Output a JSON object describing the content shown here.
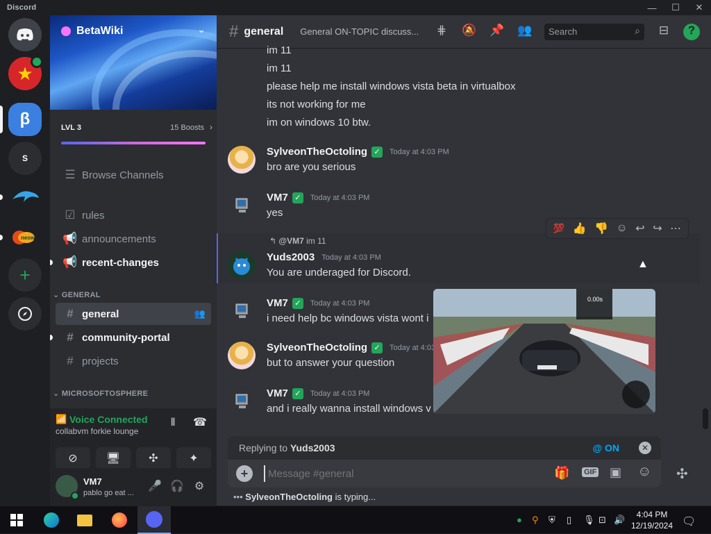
{
  "app": {
    "title": "Discord"
  },
  "window_controls": {
    "minimize": "—",
    "maximize": "☐",
    "close": "✕"
  },
  "servers": [
    {
      "name": "discord-home",
      "glyph": "",
      "color": "#404249"
    },
    {
      "name": "server-red",
      "glyph": "",
      "color": "#d7262a"
    },
    {
      "name": "server-betawiki",
      "glyph": "β",
      "color": "#3b7fe0"
    },
    {
      "name": "server-s",
      "glyph": "S",
      "color": "#2b2d31"
    },
    {
      "name": "server-dolphin",
      "glyph": "",
      "color": "#1e1f22"
    },
    {
      "name": "server-neowin",
      "glyph": "",
      "color": "#1e1f22"
    }
  ],
  "sidebar": {
    "server_name": "BetaWiki",
    "level": "LVL 3",
    "boosts": "15 Boosts",
    "browse": "Browse Channels",
    "channels_top": [
      {
        "name": "rules",
        "icon": "rules-icon"
      },
      {
        "name": "announcements",
        "icon": "megaphone-icon"
      },
      {
        "name": "recent-changes",
        "icon": "megaphone-icon"
      }
    ],
    "category_general": "GENERAL",
    "channels_general": [
      {
        "name": "general"
      },
      {
        "name": "community-portal"
      },
      {
        "name": "projects"
      }
    ],
    "category_ms": "MICROSOFTOSPHERE"
  },
  "voice": {
    "status": "Voice Connected",
    "location": "collabvm forkie lounge"
  },
  "user": {
    "name": "VM7",
    "status": "pablo go eat ..."
  },
  "header": {
    "channel": "general",
    "topic": "General ON-TOPIC discuss...",
    "search_placeholder": "Search"
  },
  "messages": {
    "continued": [
      "im 11",
      "im 11",
      "please help me install windows vista beta in virtualbox",
      "its not working for me",
      "im on windows 10 btw."
    ],
    "m1": {
      "author": "SylveonTheOctoling",
      "time": "Today at 4:03 PM",
      "text": "bro are you serious"
    },
    "m2": {
      "author": "VM7",
      "time": "Today at 4:03 PM",
      "text": "yes"
    },
    "m3": {
      "reply_user": "@VM7",
      "reply_text": "im 11",
      "author": "Yuds2003",
      "time": "Today at 4:03 PM",
      "text": "You are underaged for Discord."
    },
    "m4": {
      "author": "VM7",
      "time": "Today at 4:03 PM",
      "text": "i need help bc windows vista wont i"
    },
    "m5": {
      "author": "SylveonTheOctoling",
      "time": "Today at 4:03",
      "text": "but to answer your question"
    },
    "m6": {
      "author": "VM7",
      "time": "Today at 4:03 PM",
      "text": "and i really wanna install windows v"
    }
  },
  "video": {
    "timer": "0.00s"
  },
  "composer": {
    "replying_prefix": "Replying to",
    "replying_to": "Yuds2003",
    "mention": "@ ON",
    "placeholder": "Message #general"
  },
  "typing": {
    "user": "SylveonTheOctoling",
    "suffix": " is typing..."
  },
  "taskbar": {
    "time": "4:04 PM",
    "date": "12/19/2024"
  }
}
